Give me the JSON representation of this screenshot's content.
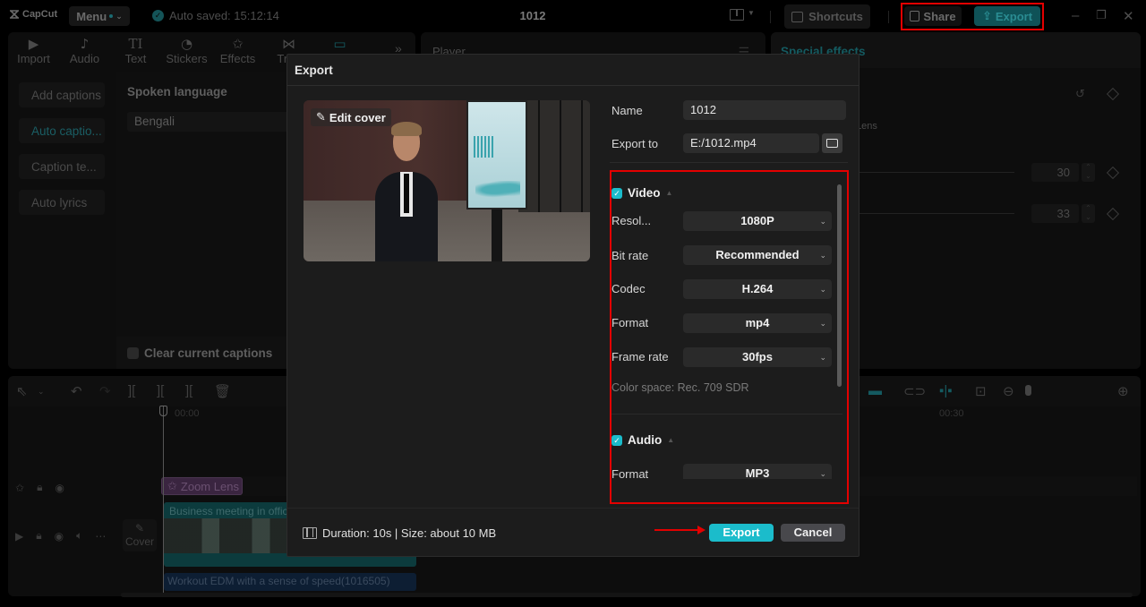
{
  "app": {
    "logo": "CapCut",
    "menu_label": "Menu",
    "autosave": "Auto saved: 15:12:14",
    "project_title": "1012",
    "shortcuts_label": "Shortcuts",
    "share_label": "Share",
    "export_label": "Export",
    "accent_color": "#1bbccb",
    "highlight_color": "#e30000"
  },
  "media_toolbar": {
    "tabs": [
      {
        "label": "Import",
        "icon": "▶"
      },
      {
        "label": "Audio",
        "icon": "♪"
      },
      {
        "label": "Text",
        "icon": "TI"
      },
      {
        "label": "Stickers",
        "icon": "◔"
      },
      {
        "label": "Effects",
        "icon": "✩"
      },
      {
        "label": "Tran",
        "icon": "⋈"
      },
      {
        "label": "",
        "icon": "▭"
      }
    ],
    "more_icon": "»"
  },
  "captions": {
    "side_items": [
      "Add captions",
      "Auto captio...",
      "Caption te...",
      "Auto lyrics"
    ],
    "active_index": 1,
    "spoken_language_label": "Spoken language",
    "spoken_language_value": "Bengali",
    "clear_captions_label": "Clear current captions"
  },
  "player": {
    "title": "Player"
  },
  "effects_panel": {
    "tab_label": "Special effects",
    "lens_label": "Lens",
    "param_values": [
      "30",
      "33"
    ]
  },
  "timeline": {
    "time_start": "00:00",
    "time_mark": "00:30",
    "effect_clip": "Zoom Lens",
    "video_clip": "Business meeting in office",
    "audio_clip": "Workout EDM with a sense of speed(1016505)",
    "cover_label": "Cover"
  },
  "export_dialog": {
    "title": "Export",
    "edit_cover_label": "Edit cover",
    "name_label": "Name",
    "name_value": "1012",
    "export_to_label": "Export to",
    "export_to_value": "E:/1012.mp4",
    "video_section": {
      "label": "Video",
      "enabled": true,
      "rows": [
        {
          "label": "Resol...",
          "value": "1080P"
        },
        {
          "label": "Bit rate",
          "value": "Recommended"
        },
        {
          "label": "Codec",
          "value": "H.264"
        },
        {
          "label": "Format",
          "value": "mp4"
        },
        {
          "label": "Frame rate",
          "value": "30fps"
        }
      ],
      "color_space": "Color space: Rec. 709 SDR"
    },
    "audio_section": {
      "label": "Audio",
      "enabled": true,
      "rows": [
        {
          "label": "Format",
          "value": "MP3"
        }
      ]
    },
    "footer_info": "Duration: 10s | Size: about 10 MB",
    "export_button": "Export",
    "cancel_button": "Cancel"
  }
}
